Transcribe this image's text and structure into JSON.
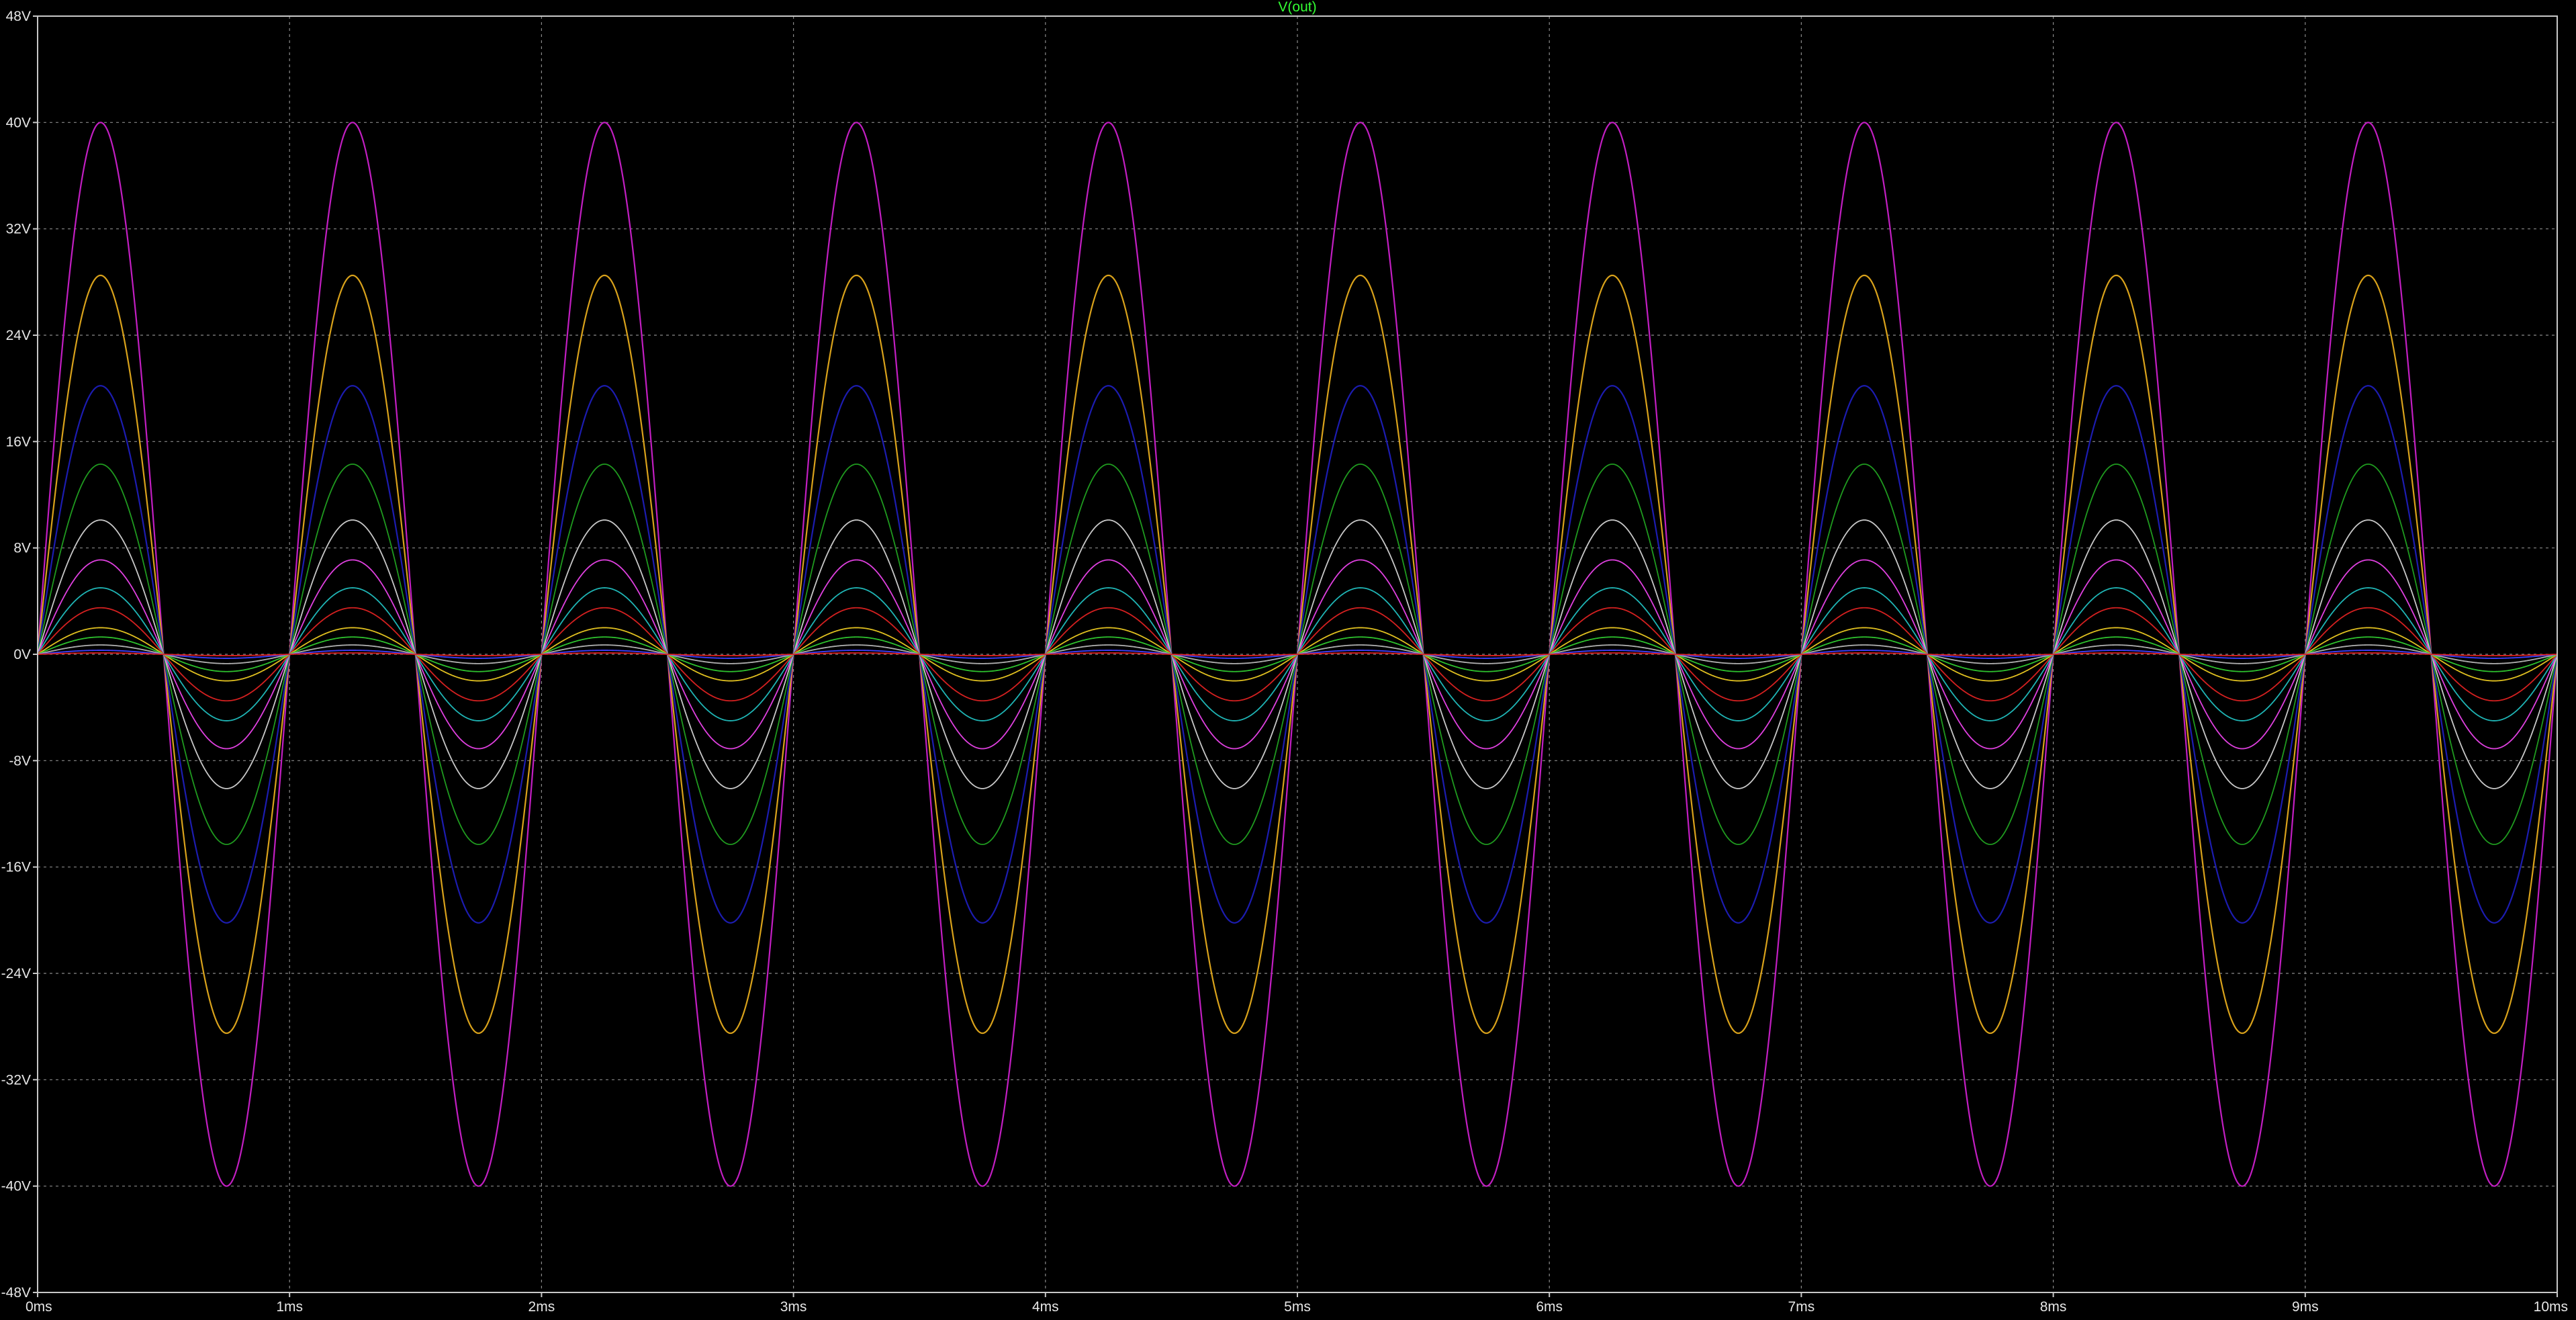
{
  "chart_data": {
    "type": "line",
    "title": "V(out)",
    "title_color": "#33ff33",
    "background_color": "#000000",
    "grid": true,
    "grid_color": "#8a8a8a",
    "axis_color": "#c8c8c8",
    "xlim": [
      0,
      10
    ],
    "ylim": [
      -48,
      48
    ],
    "x_ticks": [
      {
        "value": 0,
        "label": "0ms"
      },
      {
        "value": 1,
        "label": "1ms"
      },
      {
        "value": 2,
        "label": "2ms"
      },
      {
        "value": 3,
        "label": "3ms"
      },
      {
        "value": 4,
        "label": "4ms"
      },
      {
        "value": 5,
        "label": "5ms"
      },
      {
        "value": 6,
        "label": "6ms"
      },
      {
        "value": 7,
        "label": "7ms"
      },
      {
        "value": 8,
        "label": "8ms"
      },
      {
        "value": 9,
        "label": "9ms"
      },
      {
        "value": 10,
        "label": "10ms"
      }
    ],
    "y_ticks": [
      {
        "value": 48,
        "label": "48V"
      },
      {
        "value": 40,
        "label": "40V"
      },
      {
        "value": 32,
        "label": "32V"
      },
      {
        "value": 24,
        "label": "24V"
      },
      {
        "value": 16,
        "label": "16V"
      },
      {
        "value": 8,
        "label": "8V"
      },
      {
        "value": 0,
        "label": "0V"
      },
      {
        "value": -8,
        "label": "-8V"
      },
      {
        "value": -16,
        "label": "-16V"
      },
      {
        "value": -24,
        "label": "-24V"
      },
      {
        "value": -32,
        "label": "-32V"
      },
      {
        "value": -40,
        "label": "-40V"
      },
      {
        "value": -48,
        "label": "-48V"
      }
    ],
    "waveform": "sine",
    "frequency_khz": 1,
    "series": [
      {
        "amplitude": 40,
        "color": "#c21ec2"
      },
      {
        "amplitude": 28.5,
        "color": "#d9a21b"
      },
      {
        "amplitude": 20.2,
        "color": "#1c1cb0"
      },
      {
        "amplitude": 14.3,
        "color": "#1f9a1f"
      },
      {
        "amplitude": 10.1,
        "color": "#c8c8c8"
      },
      {
        "amplitude": 7.1,
        "color": "#e040e0"
      },
      {
        "amplitude": 5.0,
        "color": "#1fb5b5"
      },
      {
        "amplitude": 3.5,
        "color": "#d42020"
      },
      {
        "amplitude": 2.0,
        "color": "#e0c020"
      },
      {
        "amplitude": 1.3,
        "color": "#2ec22e"
      },
      {
        "amplitude": 0.7,
        "color": "#b0b0b0"
      },
      {
        "amplitude": 0.3,
        "color": "#4040ff"
      },
      {
        "amplitude": 0.1,
        "color": "#e02020"
      }
    ]
  }
}
